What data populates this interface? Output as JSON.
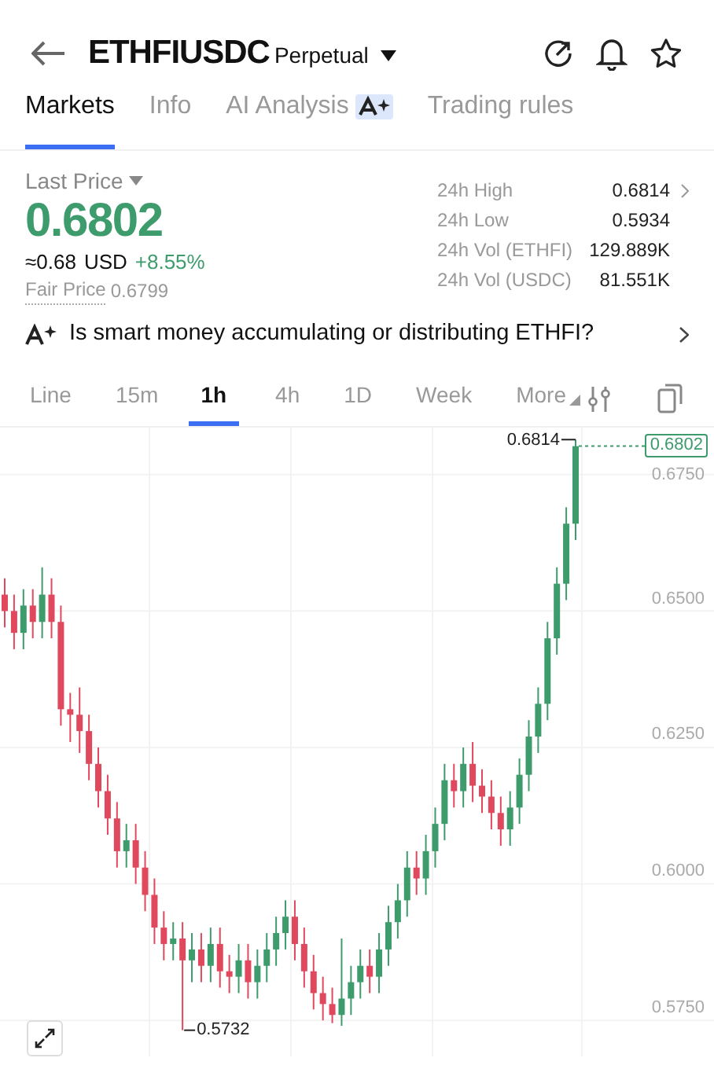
{
  "header": {
    "symbol": "ETHFIUSDC",
    "contract": "Perpetual"
  },
  "tabs": [
    {
      "label": "Markets",
      "selected": true
    },
    {
      "label": "Info",
      "selected": false
    },
    {
      "label": "AI Analysis",
      "selected": false,
      "kind": "ai"
    },
    {
      "label": "Trading rules",
      "selected": false
    }
  ],
  "price": {
    "label": "Last Price",
    "value": "0.6802",
    "usd": "≈0.68",
    "currency": "USD",
    "change": "+8.55%",
    "fair_label": "Fair Price",
    "fair_value": "0.6799"
  },
  "stats": [
    {
      "label": "24h High",
      "value": "0.6814"
    },
    {
      "label": "24h Low",
      "value": "0.5934"
    },
    {
      "label": "24h Vol (ETHFI)",
      "value": "129.889K"
    },
    {
      "label": "24h Vol (USDC)",
      "value": "81.551K"
    }
  ],
  "ai_prompt": "Is smart money accumulating or distributing ETHFI?",
  "intervals": [
    {
      "label": "Line",
      "selected": false
    },
    {
      "label": "15m",
      "selected": false
    },
    {
      "label": "1h",
      "selected": true
    },
    {
      "label": "4h",
      "selected": false
    },
    {
      "label": "1D",
      "selected": false
    },
    {
      "label": "Week",
      "selected": false
    },
    {
      "label": "More",
      "selected": false
    }
  ],
  "chart": {
    "high_marker": "0.6814",
    "low_marker": "0.5732",
    "current_price": "0.6802",
    "chart_data": {
      "type": "candlestick",
      "grid": true,
      "ylim": [
        0.5684,
        0.6836
      ],
      "yticks": [
        {
          "value": 0.675,
          "label": "0.6750"
        },
        {
          "value": 0.65,
          "label": "0.6500"
        },
        {
          "value": 0.625,
          "label": "0.6250"
        },
        {
          "value": 0.6,
          "label": "0.6000"
        },
        {
          "value": 0.575,
          "label": "0.5750"
        }
      ],
      "ohlc": [
        [
          0.653,
          0.656,
          0.647,
          0.65
        ],
        [
          0.65,
          0.653,
          0.643,
          0.646
        ],
        [
          0.646,
          0.654,
          0.643,
          0.651
        ],
        [
          0.651,
          0.654,
          0.645,
          0.648
        ],
        [
          0.648,
          0.658,
          0.645,
          0.653
        ],
        [
          0.653,
          0.656,
          0.645,
          0.648
        ],
        [
          0.648,
          0.651,
          0.629,
          0.632
        ],
        [
          0.632,
          0.635,
          0.626,
          0.631
        ],
        [
          0.631,
          0.636,
          0.624,
          0.628
        ],
        [
          0.628,
          0.631,
          0.619,
          0.622
        ],
        [
          0.622,
          0.625,
          0.614,
          0.617
        ],
        [
          0.617,
          0.62,
          0.609,
          0.612
        ],
        [
          0.612,
          0.615,
          0.603,
          0.606
        ],
        [
          0.606,
          0.611,
          0.603,
          0.608
        ],
        [
          0.608,
          0.611,
          0.6,
          0.603
        ],
        [
          0.603,
          0.606,
          0.595,
          0.598
        ],
        [
          0.598,
          0.601,
          0.589,
          0.592
        ],
        [
          0.592,
          0.595,
          0.586,
          0.589
        ],
        [
          0.589,
          0.593,
          0.586,
          0.59
        ],
        [
          0.59,
          0.593,
          0.5732,
          0.586
        ],
        [
          0.586,
          0.591,
          0.582,
          0.588
        ],
        [
          0.588,
          0.591,
          0.582,
          0.585
        ],
        [
          0.585,
          0.592,
          0.582,
          0.589
        ],
        [
          0.589,
          0.592,
          0.581,
          0.584
        ],
        [
          0.584,
          0.587,
          0.58,
          0.583
        ],
        [
          0.583,
          0.589,
          0.58,
          0.586
        ],
        [
          0.586,
          0.589,
          0.579,
          0.582
        ],
        [
          0.582,
          0.588,
          0.579,
          0.585
        ],
        [
          0.585,
          0.591,
          0.582,
          0.588
        ],
        [
          0.588,
          0.594,
          0.585,
          0.591
        ],
        [
          0.591,
          0.597,
          0.588,
          0.594
        ],
        [
          0.594,
          0.597,
          0.586,
          0.589
        ],
        [
          0.589,
          0.592,
          0.581,
          0.584
        ],
        [
          0.584,
          0.587,
          0.577,
          0.58
        ],
        [
          0.58,
          0.583,
          0.575,
          0.578
        ],
        [
          0.578,
          0.581,
          0.5745,
          0.576
        ],
        [
          0.576,
          0.59,
          0.574,
          0.579
        ],
        [
          0.579,
          0.585,
          0.576,
          0.582
        ],
        [
          0.582,
          0.588,
          0.579,
          0.585
        ],
        [
          0.585,
          0.588,
          0.58,
          0.583
        ],
        [
          0.583,
          0.591,
          0.58,
          0.588
        ],
        [
          0.588,
          0.596,
          0.585,
          0.593
        ],
        [
          0.593,
          0.6,
          0.59,
          0.597
        ],
        [
          0.597,
          0.606,
          0.594,
          0.603
        ],
        [
          0.603,
          0.606,
          0.598,
          0.601
        ],
        [
          0.601,
          0.609,
          0.598,
          0.606
        ],
        [
          0.606,
          0.614,
          0.603,
          0.611
        ],
        [
          0.611,
          0.622,
          0.608,
          0.619
        ],
        [
          0.619,
          0.622,
          0.614,
          0.617
        ],
        [
          0.617,
          0.625,
          0.614,
          0.622
        ],
        [
          0.622,
          0.626,
          0.615,
          0.618
        ],
        [
          0.618,
          0.621,
          0.613,
          0.616
        ],
        [
          0.616,
          0.619,
          0.61,
          0.613
        ],
        [
          0.613,
          0.616,
          0.607,
          0.61
        ],
        [
          0.61,
          0.617,
          0.607,
          0.614
        ],
        [
          0.614,
          0.623,
          0.611,
          0.62
        ],
        [
          0.62,
          0.63,
          0.617,
          0.627
        ],
        [
          0.627,
          0.636,
          0.624,
          0.633
        ],
        [
          0.633,
          0.648,
          0.63,
          0.645
        ],
        [
          0.645,
          0.658,
          0.642,
          0.655
        ],
        [
          0.655,
          0.669,
          0.652,
          0.666
        ],
        [
          0.666,
          0.6814,
          0.663,
          0.6802
        ]
      ]
    }
  }
}
